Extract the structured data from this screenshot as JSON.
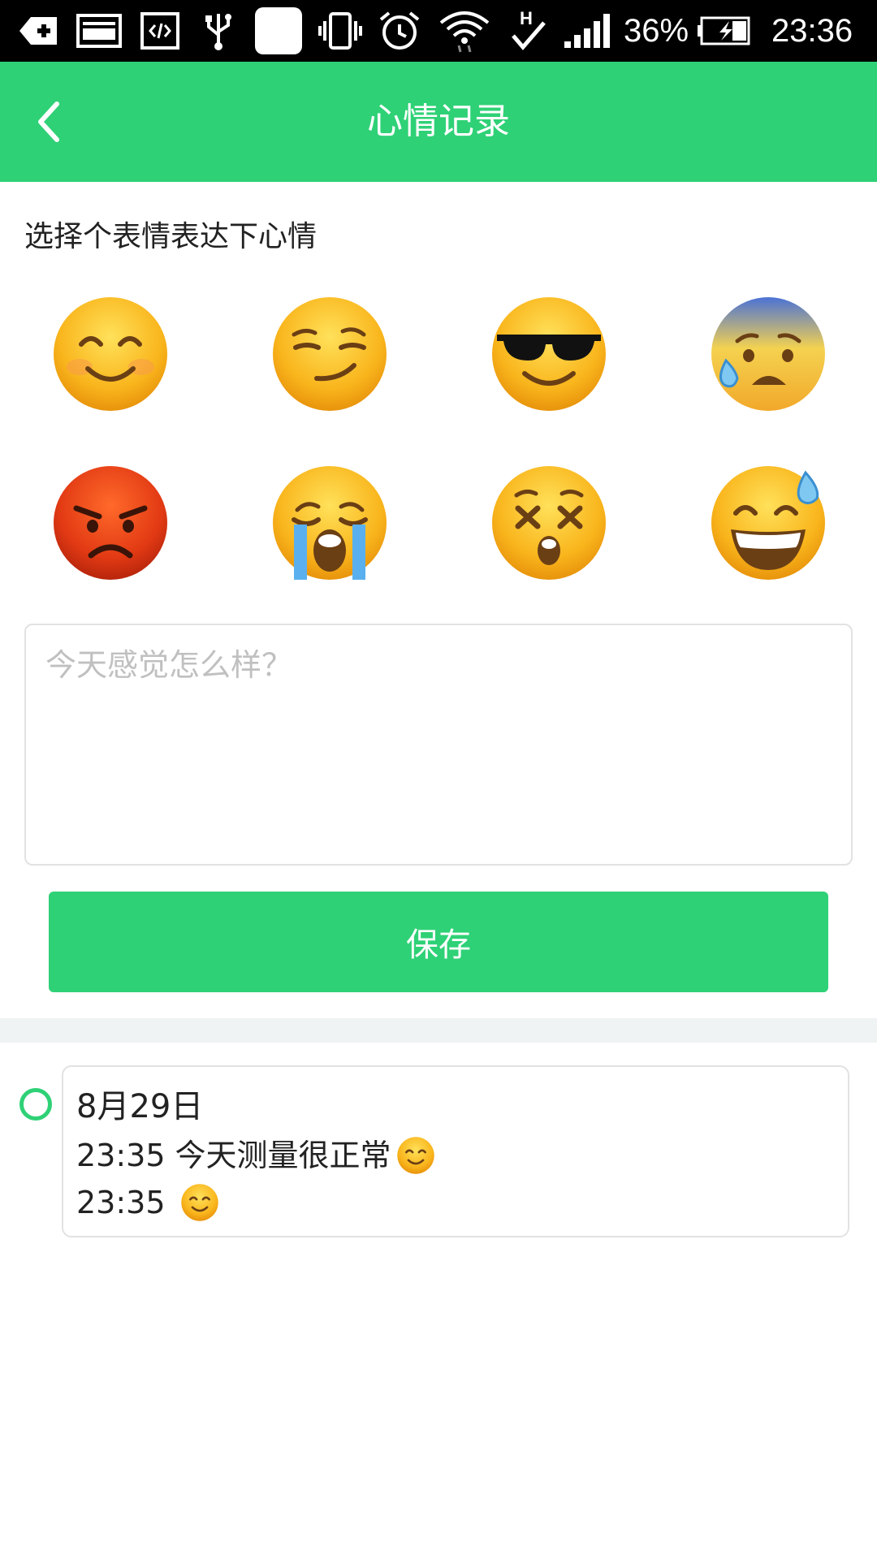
{
  "status_bar": {
    "battery_percent": "36%",
    "time": "23:36",
    "signal_label": "H",
    "icons": [
      "add-icon",
      "image-icon",
      "code-icon",
      "usb-icon",
      "blank-notification-icon",
      "vibrate-icon",
      "alarm-icon",
      "wifi-icon",
      "hspa-icon",
      "signal-icon",
      "battery-charging-icon"
    ]
  },
  "app_bar": {
    "title": "心情记录",
    "back_icon": "chevron-left-icon"
  },
  "prompt": "选择个表情表达下心情",
  "emojis": [
    {
      "name": "smiling-face"
    },
    {
      "name": "smirking-face"
    },
    {
      "name": "sunglasses-face"
    },
    {
      "name": "anxious-sweat-face"
    },
    {
      "name": "angry-face"
    },
    {
      "name": "crying-face"
    },
    {
      "name": "dizzy-face"
    },
    {
      "name": "grinning-sweat-face"
    }
  ],
  "mood_input": {
    "value": "",
    "placeholder": "今天感觉怎么样？"
  },
  "save_button": "保存",
  "timeline": [
    {
      "date": "8月29日",
      "entries": [
        {
          "time": "23:35",
          "text": "今天测量很正常",
          "emoji": "smiling-face"
        },
        {
          "time": "23:35",
          "text": "",
          "emoji": "smiling-face"
        }
      ]
    }
  ],
  "colors": {
    "accent": "#2fd176",
    "status_bar": "#000000",
    "divider": "#f0f3f3",
    "placeholder": "#c0c0c0"
  }
}
